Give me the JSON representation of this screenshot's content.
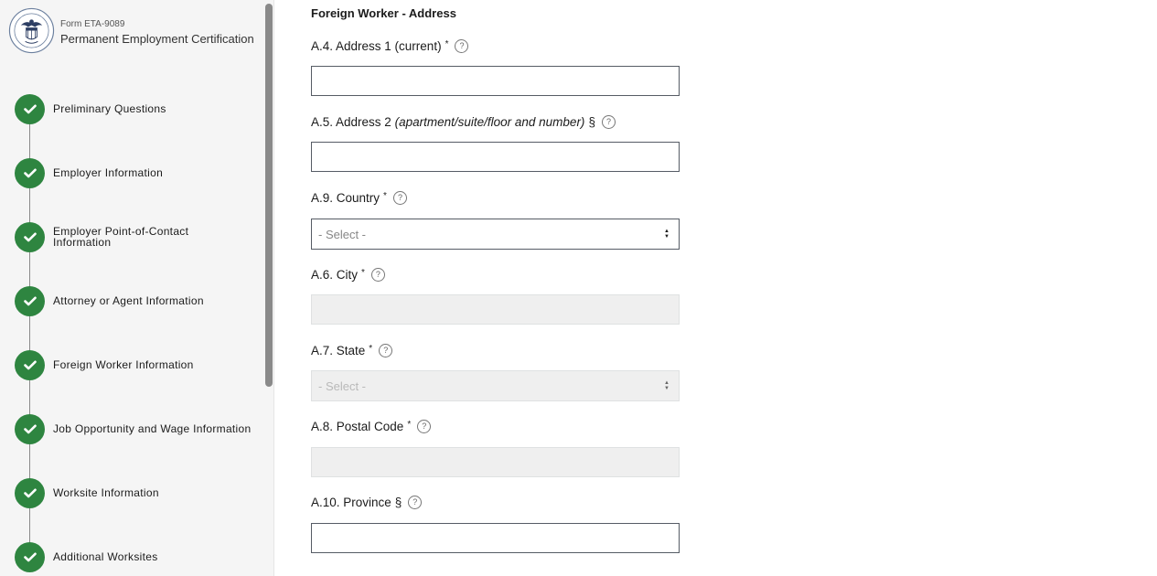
{
  "brand": {
    "form_number": "Form ETA-9089",
    "title": "Permanent Employment Certification"
  },
  "steps": [
    {
      "label": "Preliminary Questions",
      "status": "complete"
    },
    {
      "label": "Employer Information",
      "status": "complete"
    },
    {
      "label": "Employer Point-of-Contact Information",
      "status": "complete"
    },
    {
      "label": "Attorney or Agent Information",
      "status": "complete"
    },
    {
      "label": "Foreign Worker Information",
      "status": "complete"
    },
    {
      "label": "Job Opportunity and Wage Information",
      "status": "complete"
    },
    {
      "label": "Worksite Information",
      "status": "complete"
    },
    {
      "label": "Additional Worksites",
      "status": "complete"
    }
  ],
  "form": {
    "section_title": "Foreign Worker - Address",
    "address1": {
      "label": "A.4. Address 1 (current)",
      "marker": "*",
      "value": ""
    },
    "address2": {
      "label": "A.5. Address 2",
      "hint": "(apartment/suite/floor and number)",
      "marker": "§",
      "value": ""
    },
    "country": {
      "label": "A.9. Country",
      "marker": "*",
      "value": "- Select -"
    },
    "city": {
      "label": "A.6. City",
      "marker": "*",
      "value": "",
      "disabled": true
    },
    "state": {
      "label": "A.7. State",
      "marker": "*",
      "value": "- Select -",
      "disabled": true
    },
    "postal": {
      "label": "A.8. Postal Code",
      "marker": "*",
      "value": "",
      "disabled": true
    },
    "province": {
      "label": "A.10. Province",
      "marker": "§",
      "value": ""
    }
  },
  "help_glyph": "?",
  "colors": {
    "step_complete": "#2e8540",
    "input_border": "#565c65",
    "disabled_bg": "#efefef"
  }
}
